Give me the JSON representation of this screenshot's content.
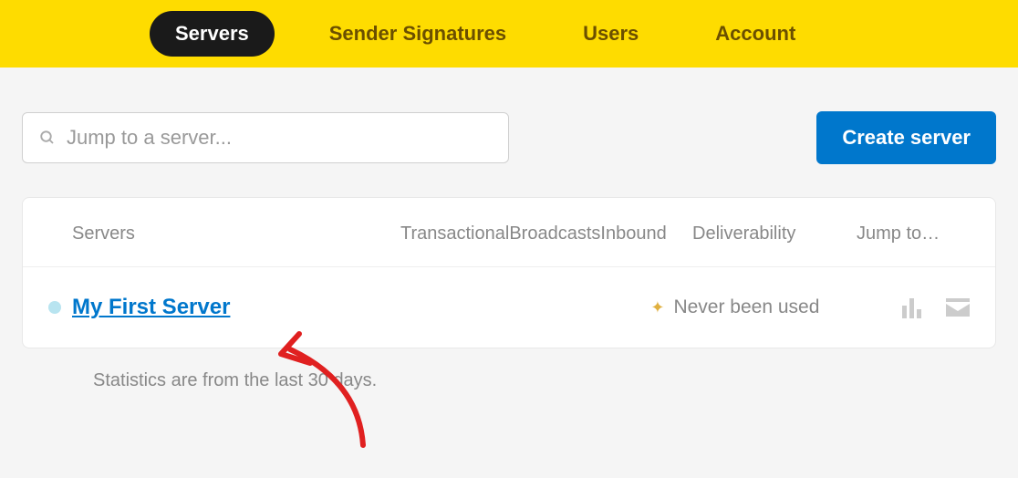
{
  "nav": {
    "tabs": [
      {
        "label": "Servers",
        "active": true
      },
      {
        "label": "Sender Signatures",
        "active": false
      },
      {
        "label": "Users",
        "active": false
      },
      {
        "label": "Account",
        "active": false
      }
    ]
  },
  "search": {
    "placeholder": "Jump to a server..."
  },
  "create_button": "Create server",
  "table": {
    "headers": {
      "servers": "Servers",
      "transactional": "Transactional",
      "broadcasts": "Broadcasts",
      "inbound": "Inbound",
      "deliverability": "Deliverability",
      "jump": "Jump to…"
    },
    "rows": [
      {
        "name": "My First Server",
        "dot_color": "#b8e4f0",
        "deliverability_text": "Never been used"
      }
    ]
  },
  "footnote": "Statistics are from the last 30 days.",
  "colors": {
    "nav_bg": "#fedc00",
    "accent": "#0077cc"
  }
}
